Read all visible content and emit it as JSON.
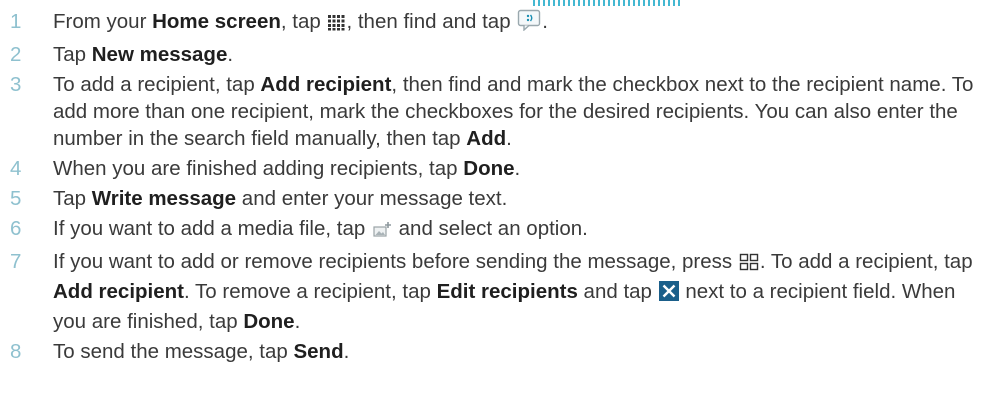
{
  "steps": [
    {
      "num": "1",
      "t1": "From your ",
      "b1": "Home screen",
      "t2": ", tap ",
      "t3": ", then find and tap ",
      "t4": "."
    },
    {
      "num": "2",
      "t1": "Tap ",
      "b1": "New message",
      "t2": "."
    },
    {
      "num": "3",
      "t1": "To add a recipient, tap ",
      "b1": "Add recipient",
      "t2": ", then find and mark the checkbox next to the recipient name. To add more than one recipient, mark the checkboxes for the desired recipients. You can also enter the number in the search field manually, then tap ",
      "b2": "Add",
      "t3": "."
    },
    {
      "num": "4",
      "t1": "When you are finished adding recipients, tap ",
      "b1": "Done",
      "t2": "."
    },
    {
      "num": "5",
      "t1": "Tap ",
      "b1": "Write message",
      "t2": " and enter your message text."
    },
    {
      "num": "6",
      "t1": "If you want to add a media file, tap ",
      "t2": " and select an option."
    },
    {
      "num": "7",
      "t1": "If you want to add or remove recipients before sending the message, press ",
      "t2": ". To add a recipient, tap ",
      "b1": "Add recipient",
      "t3": ". To remove a recipient, tap ",
      "b2": "Edit recipients",
      "t4": " and tap ",
      "t5": " next to a recipient field. When you are finished, tap ",
      "b3": "Done",
      "t6": "."
    },
    {
      "num": "8",
      "t1": "To send the message, tap ",
      "b1": "Send",
      "t2": "."
    }
  ],
  "icons": {
    "apps": "app-grid-icon",
    "messaging": "messaging-icon",
    "attach": "attach-media-icon",
    "menu": "menu-icon",
    "remove": "remove-x-icon"
  },
  "colors": {
    "step_number": "#8fc1cf",
    "text": "#3a3a3a",
    "bold": "#1f1f1f",
    "accent": "#15a6c6",
    "remove_icon": "#1b5f8a"
  }
}
